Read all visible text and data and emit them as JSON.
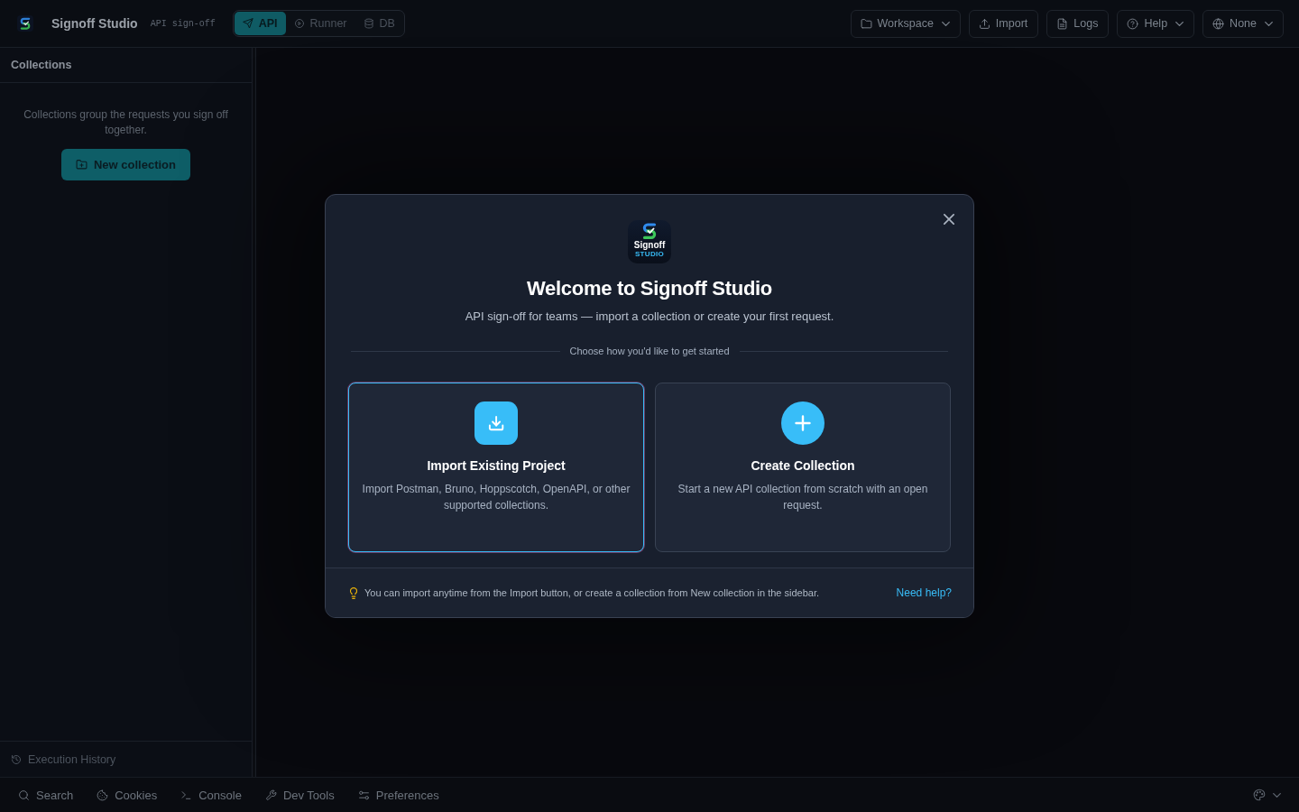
{
  "top_bar": {
    "app_name": "Signoff Studio",
    "tagline": "API sign-off",
    "mode_tabs": [
      {
        "label": "API",
        "selected": true
      },
      {
        "label": "Runner",
        "selected": false
      },
      {
        "label": "DB",
        "selected": false
      }
    ],
    "actions": [
      {
        "label": "Workspace",
        "dropdown": true
      },
      {
        "label": "Import",
        "dropdown": false
      },
      {
        "label": "Logs",
        "dropdown": false
      },
      {
        "label": "Help",
        "dropdown": true
      },
      {
        "label": "None",
        "dropdown": true
      }
    ]
  },
  "sidebar": {
    "title": "Collections",
    "empty_message": "Collections group the requests you sign off together.",
    "new_collection_button": "New collection",
    "footer_link": "Execution History"
  },
  "welcome_dialog": {
    "logo": {
      "wordmark": "Signoff",
      "subtitle": "STUDIO"
    },
    "title": "Welcome to Signoff Studio",
    "subtitle": "API sign-off for teams — import a collection or create your first request.",
    "divider_label": "Choose how you'd like to get started",
    "options": [
      {
        "kind": "import",
        "title": "Import Existing Project",
        "description": "Import Postman, Bruno, Hoppscotch, OpenAPI, or other supported collections.",
        "selected": true
      },
      {
        "kind": "create",
        "title": "Create Collection",
        "description": "Start a new API collection from scratch with an open request.",
        "selected": false
      }
    ],
    "tip": "You can import anytime from the Import button, or create a collection from New collection in the sidebar.",
    "help_link": "Need help?"
  },
  "status_bar": {
    "tools": [
      {
        "label": "Search"
      },
      {
        "label": "Cookies"
      },
      {
        "label": "Console"
      },
      {
        "label": "Dev Tools"
      },
      {
        "label": "Preferences"
      }
    ]
  }
}
